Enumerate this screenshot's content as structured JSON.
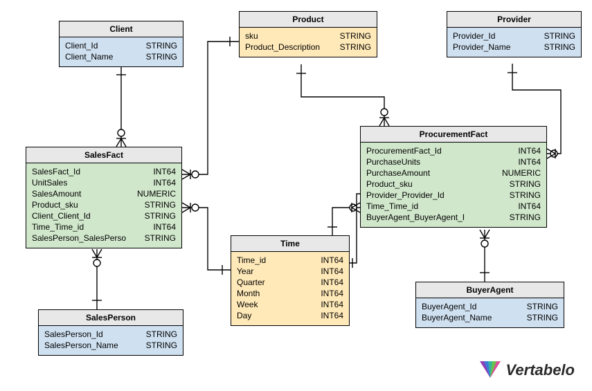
{
  "tables": {
    "client": {
      "title": "Client",
      "cols": [
        {
          "name": "Client_Id",
          "type": "STRING"
        },
        {
          "name": "Client_Name",
          "type": "STRING"
        }
      ]
    },
    "product": {
      "title": "Product",
      "cols": [
        {
          "name": "sku",
          "type": "STRING"
        },
        {
          "name": "Product_Description",
          "type": "STRING"
        }
      ]
    },
    "provider": {
      "title": "Provider",
      "cols": [
        {
          "name": "Provider_Id",
          "type": "STRING"
        },
        {
          "name": "Provider_Name",
          "type": "STRING"
        }
      ]
    },
    "salesfact": {
      "title": "SalesFact",
      "cols": [
        {
          "name": "SalesFact_Id",
          "type": "INT64"
        },
        {
          "name": "UnitSales",
          "type": "INT64"
        },
        {
          "name": "SalesAmount",
          "type": "NUMERIC"
        },
        {
          "name": "Product_sku",
          "type": "STRING"
        },
        {
          "name": "Client_Client_Id",
          "type": "STRING"
        },
        {
          "name": "Time_Time_id",
          "type": "INT64"
        },
        {
          "name": "SalesPerson_SalesPerso",
          "type": "STRING"
        }
      ]
    },
    "procurementfact": {
      "title": "ProcurementFact",
      "cols": [
        {
          "name": "ProcurementFact_Id",
          "type": "INT64"
        },
        {
          "name": "PurchaseUnits",
          "type": "INT64"
        },
        {
          "name": "PurchaseAmount",
          "type": "NUMERIC"
        },
        {
          "name": "Product_sku",
          "type": "STRING"
        },
        {
          "name": "Provider_Provider_Id",
          "type": "STRING"
        },
        {
          "name": "Time_Time_id",
          "type": "INT64"
        },
        {
          "name": "BuyerAgent_BuyerAgent_I",
          "type": "STRING"
        }
      ]
    },
    "time": {
      "title": "Time",
      "cols": [
        {
          "name": "Time_id",
          "type": "INT64"
        },
        {
          "name": "Year",
          "type": "INT64"
        },
        {
          "name": "Quarter",
          "type": "INT64"
        },
        {
          "name": "Month",
          "type": "INT64"
        },
        {
          "name": "Week",
          "type": "INT64"
        },
        {
          "name": "Day",
          "type": "INT64"
        }
      ]
    },
    "salesperson": {
      "title": "SalesPerson",
      "cols": [
        {
          "name": "SalesPerson_Id",
          "type": "STRING"
        },
        {
          "name": "SalesPerson_Name",
          "type": "STRING"
        }
      ]
    },
    "buyeragent": {
      "title": "BuyerAgent",
      "cols": [
        {
          "name": "BuyerAgent_Id",
          "type": "STRING"
        },
        {
          "name": "BuyerAgent_Name",
          "type": "STRING"
        }
      ]
    }
  },
  "logo_text": "Vertabelo"
}
